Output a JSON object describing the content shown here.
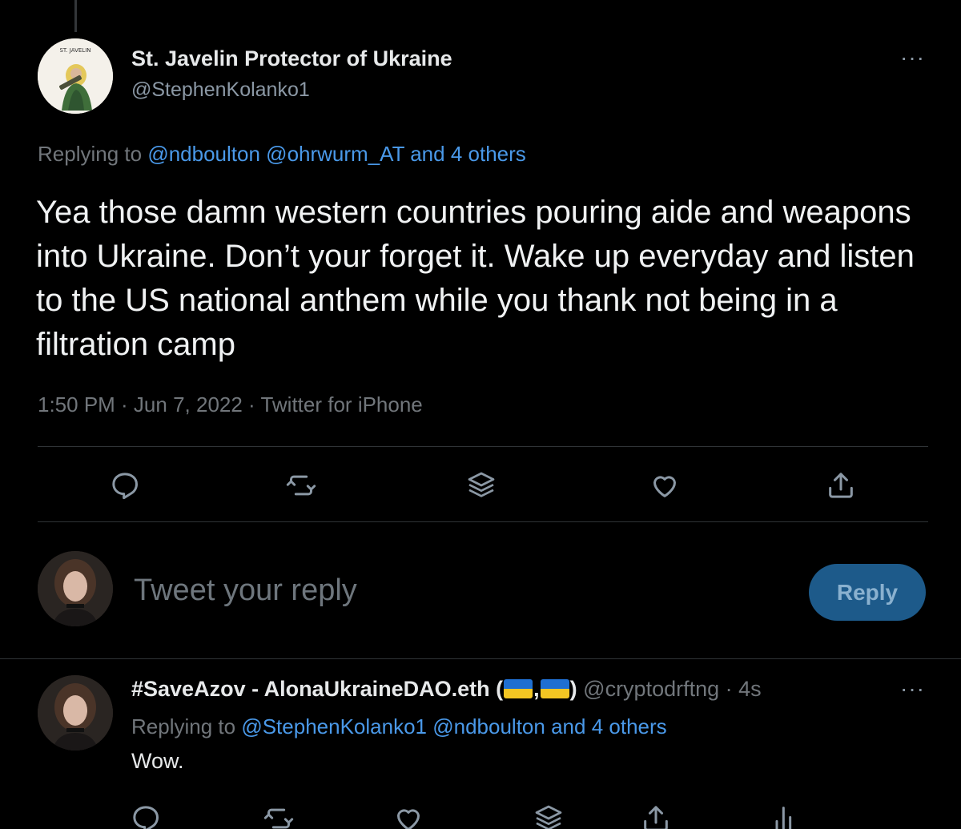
{
  "main_tweet": {
    "author_name": "St. Javelin Protector of Ukraine",
    "handle": "@StephenKolanko1",
    "avatar_label": "ST. JAVELIN",
    "more": "···",
    "replying_prefix": "Replying to ",
    "replying_mention_1": "@ndboulton",
    "replying_mention_2": "@ohrwurm_AT",
    "replying_others": "and 4 others",
    "text": "Yea those damn western countries pouring aide and weapons into Ukraine. Don’t your forget it. Wake up everyday and listen to the US national anthem while you thank not being in a filtration camp",
    "meta": "1:50 PM · Jun 7, 2022 · Twitter for iPhone"
  },
  "actions": {
    "icons": [
      "reply-icon",
      "retweet-icon",
      "stack-icon",
      "like-icon",
      "share-icon"
    ]
  },
  "compose": {
    "placeholder": "Tweet your reply",
    "reply_label": "Reply"
  },
  "reply_tweet": {
    "author_name_prefix": "#SaveAzov - AlonaUkraineDAO.eth (",
    "author_name_sep": ",",
    "author_name_suffix": ")",
    "handle_time": "@cryptodrftng · 4s",
    "more": "···",
    "replying_prefix": "Replying to ",
    "replying_mention_1": "@StephenKolanko1",
    "replying_mention_2": "@ndboulton",
    "replying_others": "and 4 others",
    "text": "Wow."
  },
  "colors": {
    "background": "#000000",
    "link": "#4a99e9",
    "muted": "#71767b",
    "reply_button": "#1d5a8a",
    "flag_blue": "#1f6fd1",
    "flag_yellow": "#f3c623"
  }
}
